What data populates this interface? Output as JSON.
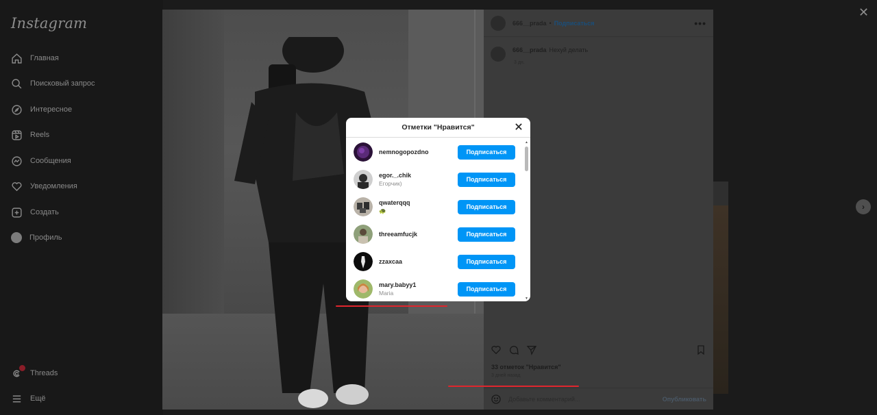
{
  "app": {
    "logo": "Instagram"
  },
  "sidebar": {
    "items": [
      {
        "label": "Главная",
        "icon": "home-icon"
      },
      {
        "label": "Поисковый запрос",
        "icon": "search-icon"
      },
      {
        "label": "Интересное",
        "icon": "compass-icon"
      },
      {
        "label": "Reels",
        "icon": "reels-icon"
      },
      {
        "label": "Сообщения",
        "icon": "messenger-icon"
      },
      {
        "label": "Уведомления",
        "icon": "heart-icon"
      },
      {
        "label": "Создать",
        "icon": "plus-square-icon"
      },
      {
        "label": "Профиль",
        "icon": "profile-avatar"
      }
    ],
    "bottom": [
      {
        "label": "Threads",
        "icon": "threads-icon"
      },
      {
        "label": "Ещё",
        "icon": "menu-icon"
      }
    ]
  },
  "post": {
    "author": "666__prada",
    "separator": "•",
    "follow_label": "Подписаться",
    "more_icon": "•••",
    "caption_author": "666__prada",
    "caption_text": "Нехуй делать",
    "caption_time": "3 дн.",
    "likes_text": "33 отметок \"Нравится\"",
    "time_ago": "3 дней назад",
    "comment_placeholder": "Добавьте комментарий...",
    "publish_label": "Опубликовать"
  },
  "modal": {
    "title": "Отметки \"Нравится\"",
    "users": [
      {
        "username": "nemnogopozdno",
        "full_name": "",
        "follow_label": "Подписаться"
      },
      {
        "username": "egor._.chik",
        "full_name": "Егорчик)",
        "follow_label": "Подписаться"
      },
      {
        "username": "qwaterqqq",
        "full_name": "🐢",
        "follow_label": "Подписаться"
      },
      {
        "username": "threeamfucjk",
        "full_name": "",
        "follow_label": "Подписаться"
      },
      {
        "username": "zzaxcaa",
        "full_name": "",
        "follow_label": "Подписаться"
      },
      {
        "username": "mary.babyy1",
        "full_name": "Maria",
        "follow_label": "Подписаться"
      }
    ]
  },
  "controls": {
    "close_symbol": "✕",
    "next_symbol": "›"
  },
  "colors": {
    "follow_button": "#0095f6",
    "annotation_line": "#e0252d"
  }
}
